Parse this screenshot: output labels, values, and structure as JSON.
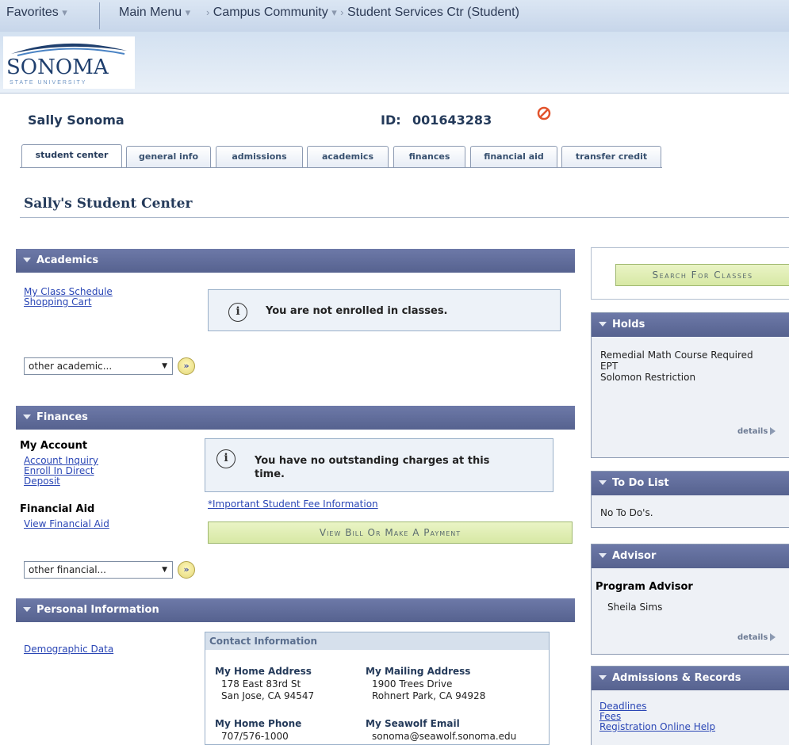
{
  "nav": {
    "favorites": "Favorites",
    "main_menu": "Main Menu",
    "crumb1": "Campus Community",
    "crumb2": "Student Services Ctr (Student)"
  },
  "logo": {
    "word": "SONOMA",
    "sub": "STATE UNIVERSITY"
  },
  "student": {
    "name": "Sally Sonoma",
    "id_label": "ID:",
    "id_value": "001643283"
  },
  "tabs": [
    "student center",
    "general info",
    "admissions",
    "academics",
    "finances",
    "financial aid",
    "transfer credit"
  ],
  "page_title": "Sally's Student Center",
  "academics": {
    "header": "Academics",
    "links": [
      "My Class Schedule",
      "Shopping Cart"
    ],
    "message": "You are not enrolled in classes.",
    "select": "other academic..."
  },
  "finances": {
    "header": "Finances",
    "my_account": "My Account",
    "account_links": [
      "Account Inquiry",
      "Enroll In Direct",
      "Deposit"
    ],
    "financial_aid": "Financial Aid",
    "aid_link": "View Financial Aid",
    "message_line1": "You have no outstanding charges at this",
    "message_line2": "time.",
    "fee_link": "*Important Student Fee Information",
    "pay_button": "View Bill Or Make A Payment",
    "select": "other financial..."
  },
  "personal": {
    "header": "Personal Information",
    "demographic_link": "Demographic Data",
    "contact_header": "Contact Information",
    "home_address_label": "My Home Address",
    "home_address": [
      "178 East 83rd St",
      "San Jose, CA 94547"
    ],
    "mailing_address_label": "My Mailing Address",
    "mailing_address": [
      "1900 Trees Drive",
      "Rohnert Park, CA 94928"
    ],
    "home_phone_label": "My Home Phone",
    "home_phone": "707/576-1000",
    "email_label": "My Seawolf Email",
    "email": "sonoma@seawolf.sonoma.edu"
  },
  "right": {
    "search_button": "Search For Classes",
    "holds_header": "Holds",
    "holds": [
      "Remedial Math Course Required",
      "EPT",
      "Solomon Restriction"
    ],
    "details": "details",
    "todo_header": "To Do List",
    "todo_text": "No To Do's.",
    "advisor_header": "Advisor",
    "advisor_label": "Program Advisor",
    "advisor_name": "Sheila Sims",
    "admissions_header": "Admissions & Records",
    "admissions_links": [
      "Deadlines",
      "Fees",
      "Registration Online Help"
    ]
  },
  "colors": {
    "section_header": "#5f6b9a",
    "link": "#2a46b5",
    "button_green": "#d7e8a4"
  }
}
